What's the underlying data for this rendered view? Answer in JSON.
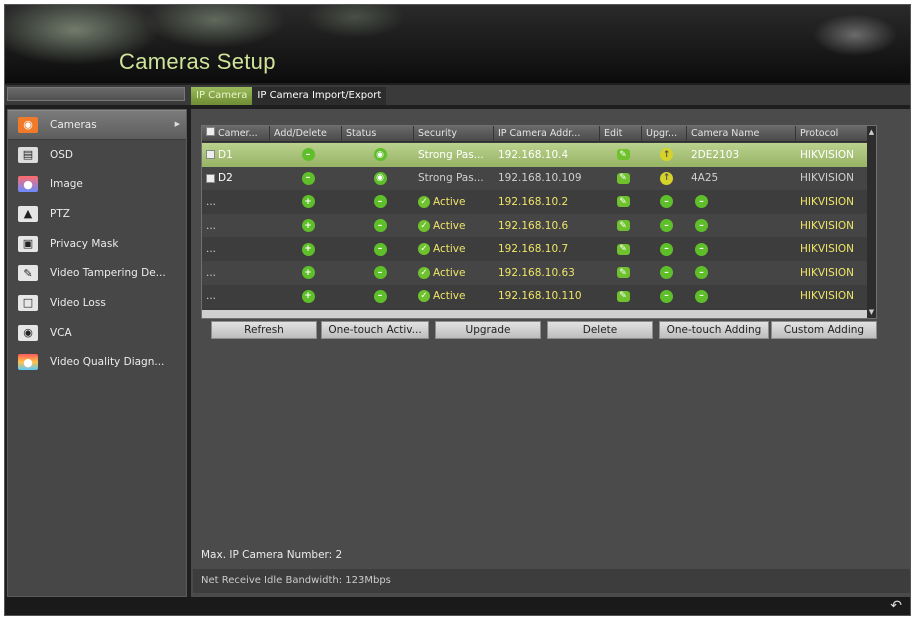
{
  "window": {
    "title": "Cameras Setup"
  },
  "tabs": [
    {
      "label": "IP Camera",
      "active": true
    },
    {
      "label": "IP Camera Import/Export",
      "active": false
    }
  ],
  "sidebar": {
    "items": [
      {
        "label": "Cameras",
        "icon": "camera-icon",
        "active": true
      },
      {
        "label": "OSD",
        "icon": "osd-icon",
        "active": false
      },
      {
        "label": "Image",
        "icon": "image-icon",
        "active": false
      },
      {
        "label": "PTZ",
        "icon": "ptz-icon",
        "active": false
      },
      {
        "label": "Privacy Mask",
        "icon": "privacy-mask-icon",
        "active": false
      },
      {
        "label": "Video Tampering De...",
        "icon": "video-tampering-icon",
        "active": false
      },
      {
        "label": "Video Loss",
        "icon": "video-loss-icon",
        "active": false
      },
      {
        "label": "VCA",
        "icon": "vca-icon",
        "active": false
      },
      {
        "label": "Video Quality Diagn...",
        "icon": "video-quality-icon",
        "active": false
      }
    ]
  },
  "table": {
    "columns": [
      "Camer...",
      "Add/Delete",
      "Status",
      "Security",
      "IP Camera Addr...",
      "Edit",
      "Upgr...",
      "Camera Name",
      "Protocol"
    ],
    "rows": [
      {
        "camera": "D1",
        "add_delete": "delete-icon",
        "status": "online-icon",
        "security": "Strong Pas...",
        "ip": "192.168.10.4",
        "edit": "pencil-icon",
        "upgrade": "upgrade-icon",
        "name": "2DE2103",
        "protocol": "HIKVISION",
        "selected": true
      },
      {
        "camera": "D2",
        "add_delete": "delete-icon",
        "status": "online-icon",
        "security": "Strong Pas...",
        "ip": "192.168.10.109",
        "edit": "pencil-icon",
        "upgrade": "upgrade-icon",
        "name": "4A25",
        "protocol": "HIKVISION",
        "selected": false
      },
      {
        "camera": "...",
        "add_delete": "add-icon",
        "status": "minus-icon",
        "security": "Active",
        "ip": "192.168.10.2",
        "edit": "pencil-icon",
        "upgrade": "minus-icon",
        "name": "minus-icon",
        "protocol": "HIKVISION",
        "selected": false
      },
      {
        "camera": "...",
        "add_delete": "add-icon",
        "status": "minus-icon",
        "security": "Active",
        "ip": "192.168.10.6",
        "edit": "pencil-icon",
        "upgrade": "minus-icon",
        "name": "minus-icon",
        "protocol": "HIKVISION",
        "selected": false
      },
      {
        "camera": "...",
        "add_delete": "add-icon",
        "status": "minus-icon",
        "security": "Active",
        "ip": "192.168.10.7",
        "edit": "pencil-icon",
        "upgrade": "minus-icon",
        "name": "minus-icon",
        "protocol": "HIKVISION",
        "selected": false
      },
      {
        "camera": "...",
        "add_delete": "add-icon",
        "status": "minus-icon",
        "security": "Active",
        "ip": "192.168.10.63",
        "edit": "pencil-icon",
        "upgrade": "minus-icon",
        "name": "minus-icon",
        "protocol": "HIKVISION",
        "selected": false
      },
      {
        "camera": "...",
        "add_delete": "add-icon",
        "status": "minus-icon",
        "security": "Active",
        "ip": "192.168.10.110",
        "edit": "pencil-icon",
        "upgrade": "minus-icon",
        "name": "minus-icon",
        "protocol": "HIKVISION",
        "selected": false
      }
    ]
  },
  "buttons": {
    "refresh": "Refresh",
    "one_touch_activate": "One-touch Activ...",
    "upgrade": "Upgrade",
    "delete": "Delete",
    "one_touch_adding": "One-touch Adding",
    "custom_adding": "Custom Adding"
  },
  "footer": {
    "max_camera": "Max. IP Camera Number: 2",
    "bandwidth": "Net Receive Idle Bandwidth: 123Mbps"
  },
  "colors": {
    "accent": "#97b365",
    "title": "#cfe39a",
    "active_text": "#f0e56a",
    "icon_green": "#5fbf2a"
  }
}
